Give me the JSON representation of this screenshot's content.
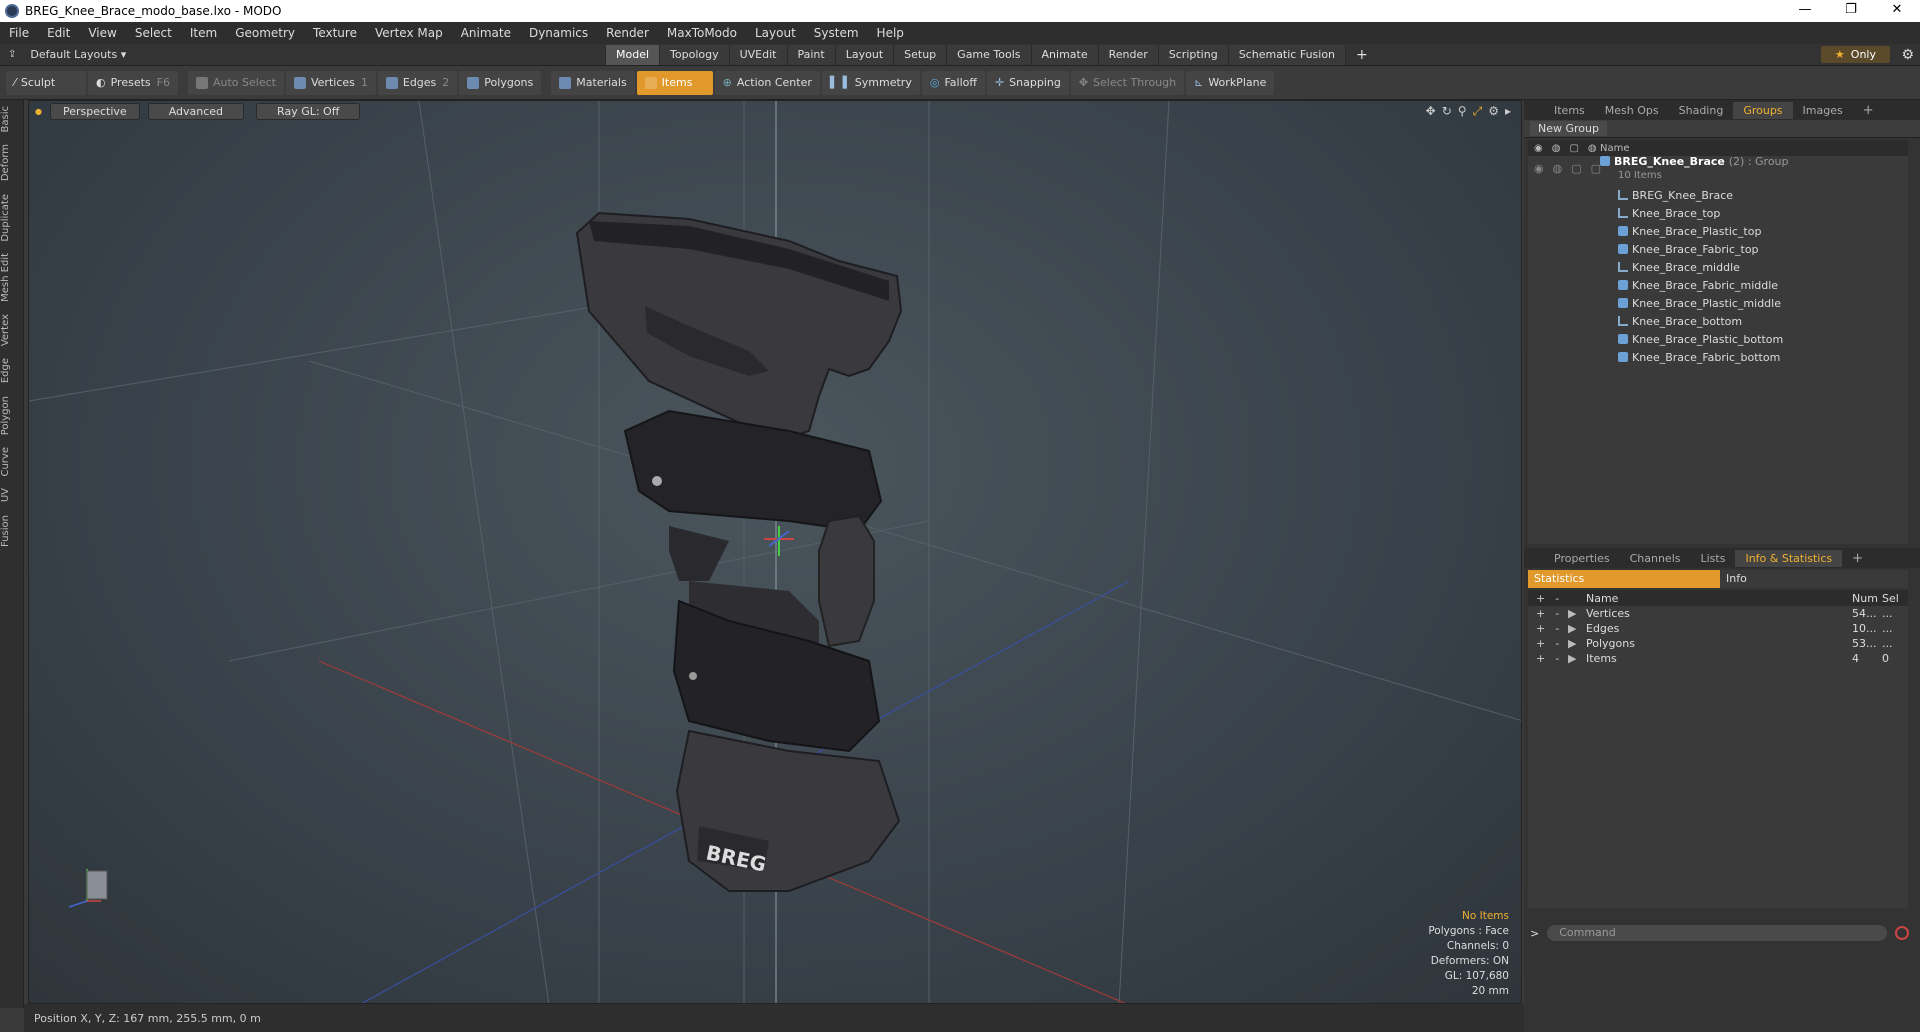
{
  "window": {
    "title": "BREG_Knee_Brace_modo_base.lxo - MODO",
    "minimize": "—",
    "maximize": "❐",
    "close": "✕"
  },
  "menu": [
    "File",
    "Edit",
    "View",
    "Select",
    "Item",
    "Geometry",
    "Texture",
    "Vertex Map",
    "Animate",
    "Dynamics",
    "Render",
    "MaxToModo",
    "Layout",
    "System",
    "Help"
  ],
  "layout": {
    "preset": "Default Layouts ▾",
    "tabs": [
      "Model",
      "Topology",
      "UVEdit",
      "Paint",
      "Layout",
      "Setup",
      "Game Tools",
      "Animate",
      "Render",
      "Scripting",
      "Schematic Fusion"
    ],
    "active_tab": "Model",
    "plus": "+",
    "only": "Only"
  },
  "toolbar": {
    "sculpt": "Sculpt",
    "presets": "Presets",
    "presets_key": "F6",
    "auto_select": "Auto Select",
    "vertices": "Vertices",
    "vertices_n": "1",
    "edges": "Edges",
    "edges_n": "2",
    "polygons": "Polygons",
    "materials": "Materials",
    "items": "Items",
    "action_center": "Action Center",
    "symmetry": "Symmetry",
    "falloff": "Falloff",
    "snapping": "Snapping",
    "select_through": "Select Through",
    "workplane": "WorkPlane"
  },
  "left_tabs": [
    "Basic",
    "Deform",
    "Duplicate",
    "Mesh Edit",
    "Vertex",
    "Edge",
    "Polygon",
    "Curve",
    "UV",
    "Fusion"
  ],
  "viewport": {
    "view": "Perspective",
    "mode": "Advanced",
    "raygl": "Ray GL: Off",
    "info": {
      "no_items": "No Items",
      "polygons": "Polygons : Face",
      "channels": "Channels: 0",
      "deformers": "Deformers: ON",
      "gl": "GL: 107,680",
      "scale": "20 mm"
    }
  },
  "status": {
    "position": "Position X, Y, Z:   167 mm, 255.5 mm, 0 m"
  },
  "items_panel": {
    "tabs": [
      "Items",
      "Mesh Ops",
      "Shading",
      "Groups",
      "Images"
    ],
    "active": "Groups",
    "new_group": "New Group",
    "col_name": "Name",
    "group": {
      "name": "BREG_Knee_Brace",
      "count": "(2) : Group",
      "items": "10 Items"
    },
    "children": [
      {
        "name": "BREG_Knee_Brace",
        "type": "locator"
      },
      {
        "name": "Knee_Brace_top",
        "type": "locator"
      },
      {
        "name": "Knee_Brace_Plastic_top",
        "type": "mesh"
      },
      {
        "name": "Knee_Brace_Fabric_top",
        "type": "mesh"
      },
      {
        "name": "Knee_Brace_middle",
        "type": "locator"
      },
      {
        "name": "Knee_Brace_Fabric_middle",
        "type": "mesh"
      },
      {
        "name": "Knee_Brace_Plastic_middle",
        "type": "mesh"
      },
      {
        "name": "Knee_Brace_bottom",
        "type": "locator"
      },
      {
        "name": "Knee_Brace_Plastic_bottom",
        "type": "mesh"
      },
      {
        "name": "Knee_Brace_Fabric_bottom",
        "type": "mesh"
      }
    ]
  },
  "stats_panel": {
    "tabs": [
      "Properties",
      "Channels",
      "Lists",
      "Info & Statistics"
    ],
    "active": "Info & Statistics",
    "statistics": "Statistics",
    "info": "Info",
    "cols": {
      "name": "Name",
      "num": "Num",
      "sel": "Sel"
    },
    "rows": [
      {
        "name": "Vertices",
        "num": "54...",
        "sel": "..."
      },
      {
        "name": "Edges",
        "num": "10...",
        "sel": "..."
      },
      {
        "name": "Polygons",
        "num": "53...",
        "sel": "..."
      },
      {
        "name": "Items",
        "num": "4",
        "sel": "0"
      }
    ]
  },
  "command": {
    "placeholder": "Command"
  }
}
